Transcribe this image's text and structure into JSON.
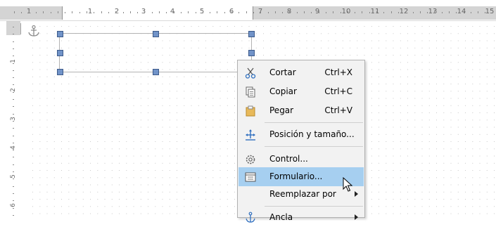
{
  "ruler": {
    "horizontal_numbers": [
      "1",
      "1",
      "2",
      "3",
      "4",
      "5",
      "6",
      "7",
      "8",
      "9",
      "10",
      "11",
      "12",
      "13",
      "14",
      "15"
    ],
    "vertical_numbers": [
      "1",
      "2",
      "3",
      "4",
      "5",
      "6"
    ]
  },
  "context_menu": {
    "items": [
      {
        "label": "Cortar",
        "shortcut": "Ctrl+X",
        "icon": "scissors-icon"
      },
      {
        "label": "Copiar",
        "shortcut": "Ctrl+C",
        "icon": "copy-icon"
      },
      {
        "label": "Pegar",
        "shortcut": "Ctrl+V",
        "icon": "paste-icon"
      },
      {
        "label": "Posición y tamaño...",
        "icon": "position-size-icon"
      },
      {
        "label": "Control...",
        "icon": "control-gear-icon"
      },
      {
        "label": "Formulario...",
        "icon": "form-icon",
        "highlighted": true
      },
      {
        "label": "Reemplazar por",
        "submenu": true
      },
      {
        "label": "Ancla",
        "icon": "anchor-icon",
        "submenu": true
      }
    ]
  },
  "colors": {
    "highlight": "#a6cff0",
    "handle": "#7193c8",
    "menu_background": "#f2f2f2"
  }
}
